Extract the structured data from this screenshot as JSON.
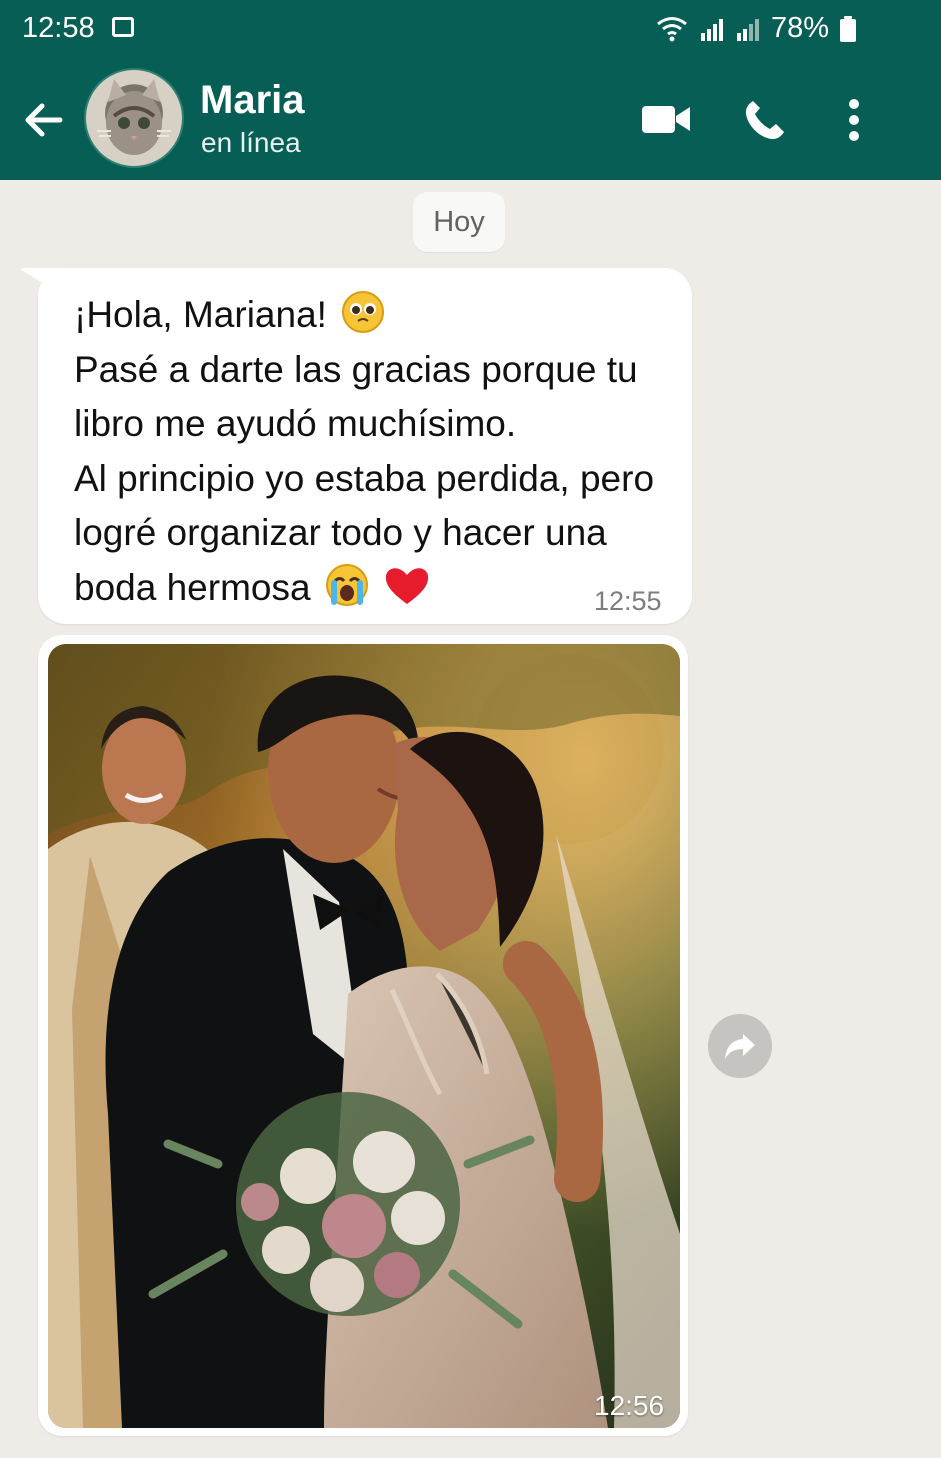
{
  "status_bar": {
    "time": "12:58",
    "battery": "78%"
  },
  "header": {
    "contact_name": "Maria",
    "contact_status": "en línea",
    "back_icon": "back-arrow-icon",
    "video_icon": "video-call-icon",
    "phone_icon": "phone-call-icon",
    "menu_icon": "more-options-icon"
  },
  "chat": {
    "date_label": "Hoy",
    "text_message": {
      "lines": [
        "¡Hola,  Mariana!",
        "Pasé a darte las gracias porque tu",
        "libro me ayudó muchísimo.",
        "Al principio yo estaba perdida, pero",
        "logré organizar todo y hacer una",
        "boda hermosa"
      ],
      "emojis": [
        "pleading-face",
        "crying-face",
        "red-heart"
      ],
      "time": "12:55"
    },
    "image_message": {
      "time": "12:56",
      "content": "wedding-photo"
    },
    "forward_icon": "forward-icon"
  },
  "colors": {
    "header": "#075e54",
    "background": "#efece7",
    "bubble": "#ffffff"
  }
}
